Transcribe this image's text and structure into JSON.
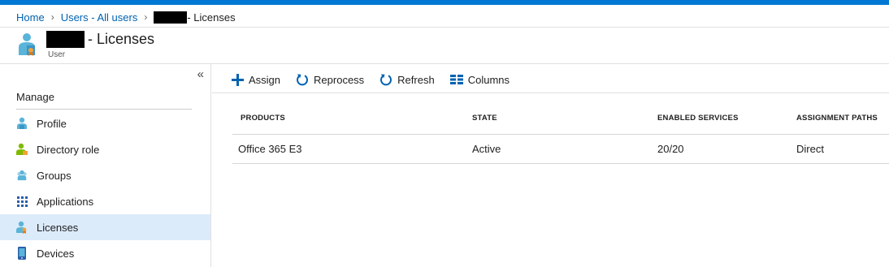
{
  "breadcrumb": {
    "home": "Home",
    "users": "Users - All users",
    "current": "- Licenses"
  },
  "page": {
    "title": "- Licenses",
    "subtitle": "User"
  },
  "sidebar": {
    "collapse_glyph": "«",
    "section_label": "Manage",
    "items": [
      {
        "label": "Profile",
        "icon": "user-icon"
      },
      {
        "label": "Directory role",
        "icon": "directory-role-icon"
      },
      {
        "label": "Groups",
        "icon": "groups-icon"
      },
      {
        "label": "Applications",
        "icon": "applications-grid-icon"
      },
      {
        "label": "Licenses",
        "icon": "license-icon",
        "active": true
      },
      {
        "label": "Devices",
        "icon": "device-icon"
      }
    ]
  },
  "toolbar": {
    "assign": "Assign",
    "reprocess": "Reprocess",
    "refresh": "Refresh",
    "columns": "Columns"
  },
  "table": {
    "headers": [
      "PRODUCTS",
      "STATE",
      "ENABLED SERVICES",
      "ASSIGNMENT PATHS"
    ],
    "rows": [
      [
        "Office 365 E3",
        "Active",
        "20/20",
        "Direct"
      ]
    ]
  },
  "colors": {
    "accent": "#0078d4",
    "link": "#0062b0",
    "active_nav": "#dcebfa"
  }
}
